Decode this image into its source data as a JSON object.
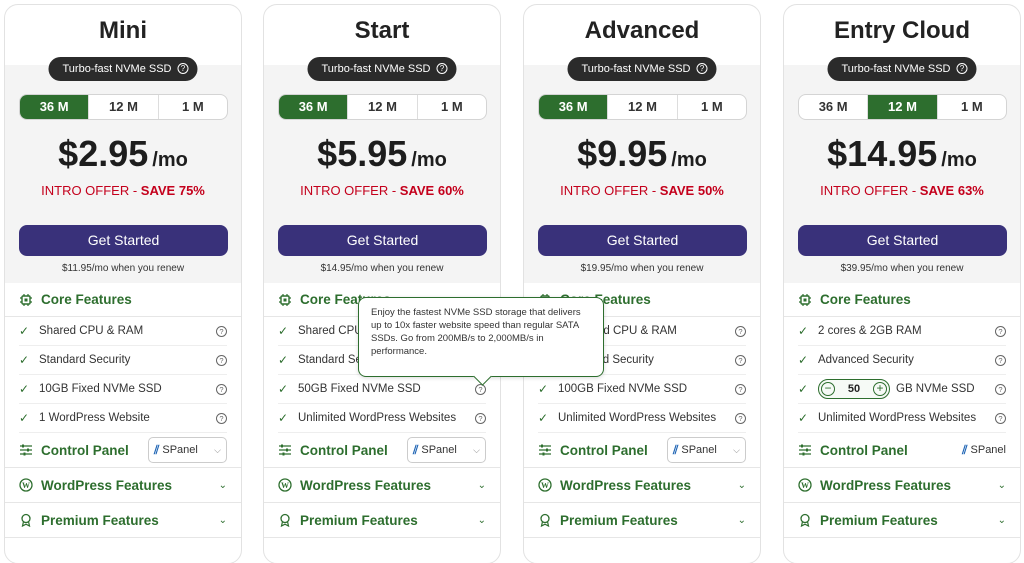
{
  "badge_text": "Turbo-fast NVMe SSD",
  "terms": [
    "36 M",
    "12 M",
    "1 M"
  ],
  "mo_label": "/mo",
  "offer_prefix": "INTRO OFFER - ",
  "cta_label": "Get Started",
  "sections": {
    "core": "Core Features",
    "control": "Control Panel",
    "wordpress": "WordPress Features",
    "premium": "Premium Features"
  },
  "spanel_label": "SPanel",
  "tooltip": "Enjoy the fastest NVMe SSD storage that delivers up to 10x faster website speed than regular SATA SSDs. Go from 200MB/s to 2,000MB/s in performance.",
  "colors": {
    "green": "#2d6e2e",
    "purple": "#39317a",
    "red": "#c4001c"
  },
  "plans": [
    {
      "name": "Mini",
      "active_term": "36 M",
      "price": "$2.95",
      "save": "SAVE 75%",
      "renew": "$11.95/mo when you renew",
      "features": [
        "Shared CPU & RAM",
        "Standard Security",
        "10GB Fixed NVMe SSD",
        "1 WordPress Website"
      ]
    },
    {
      "name": "Start",
      "active_term": "36 M",
      "price": "$5.95",
      "save": "SAVE 60%",
      "renew": "$14.95/mo when you renew",
      "features": [
        "Shared CPU & RAM",
        "Standard Security",
        "50GB Fixed NVMe SSD",
        "Unlimited WordPress Websites"
      ]
    },
    {
      "name": "Advanced",
      "active_term": "36 M",
      "price": "$9.95",
      "save": "SAVE 50%",
      "renew": "$19.95/mo when you renew",
      "features": [
        "Dedicated CPU & RAM",
        "Advanced Security",
        "100GB Fixed NVMe SSD",
        "Unlimited WordPress Websites"
      ]
    },
    {
      "name": "Entry Cloud",
      "active_term": "12 M",
      "price": "$14.95",
      "save": "SAVE 63%",
      "renew": "$39.95/mo when you renew",
      "features": [
        "2 cores & 2GB RAM",
        "Advanced Security",
        "GB NVMe SSD",
        "Unlimited WordPress Websites"
      ],
      "ssd_value": "50"
    }
  ]
}
